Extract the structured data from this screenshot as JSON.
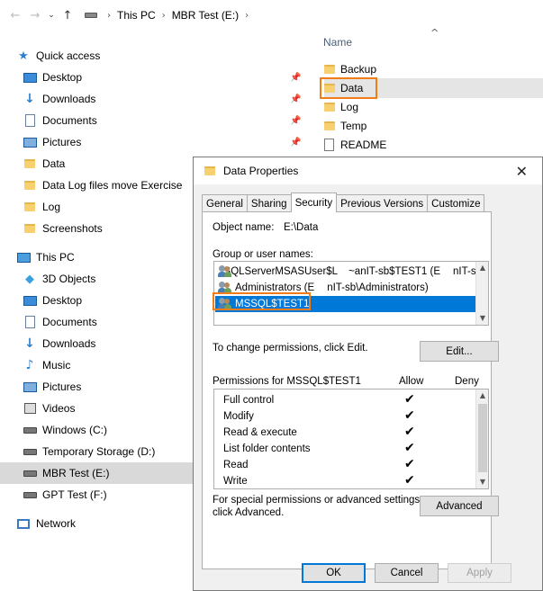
{
  "addressbar": {
    "back_icon": "arrow-left-icon",
    "forward_icon": "arrow-right-icon",
    "recent_icon": "chevron-down-icon",
    "up_icon": "arrow-up-icon",
    "breadcrumbs": [
      "This PC",
      "MBR Test (E:)"
    ]
  },
  "sidebar": {
    "quick_access_label": "Quick access",
    "quick_access": [
      {
        "label": "Desktop",
        "icon": "desktop-icon",
        "pinned": true
      },
      {
        "label": "Downloads",
        "icon": "downloads-icon",
        "pinned": true
      },
      {
        "label": "Documents",
        "icon": "documents-icon",
        "pinned": true
      },
      {
        "label": "Pictures",
        "icon": "pictures-icon",
        "pinned": true
      },
      {
        "label": "Data",
        "icon": "folder-icon",
        "pinned": false
      },
      {
        "label": "Data Log files move Exercise",
        "icon": "folder-icon",
        "pinned": false
      },
      {
        "label": "Log",
        "icon": "folder-icon",
        "pinned": false
      },
      {
        "label": "Screenshots",
        "icon": "folder-icon",
        "pinned": false
      }
    ],
    "this_pc_label": "This PC",
    "this_pc": [
      {
        "label": "3D Objects",
        "icon": "3d-objects-icon"
      },
      {
        "label": "Desktop",
        "icon": "desktop-icon"
      },
      {
        "label": "Documents",
        "icon": "documents-icon"
      },
      {
        "label": "Downloads",
        "icon": "downloads-icon"
      },
      {
        "label": "Music",
        "icon": "music-icon"
      },
      {
        "label": "Pictures",
        "icon": "pictures-icon"
      },
      {
        "label": "Videos",
        "icon": "videos-icon"
      },
      {
        "label": "Windows (C:)",
        "icon": "drive-icon"
      },
      {
        "label": "Temporary Storage (D:)",
        "icon": "drive-icon"
      },
      {
        "label": "MBR Test (E:)",
        "icon": "drive-icon",
        "selected": true
      },
      {
        "label": "GPT Test (F:)",
        "icon": "drive-icon"
      }
    ],
    "network_label": "Network"
  },
  "filepane": {
    "column_name": "Name",
    "files": [
      {
        "name": "Backup",
        "type": "folder"
      },
      {
        "name": "Data",
        "type": "folder",
        "highlighted": true
      },
      {
        "name": "Log",
        "type": "folder"
      },
      {
        "name": "Temp",
        "type": "folder"
      },
      {
        "name": "README",
        "type": "file"
      }
    ]
  },
  "dialog": {
    "title": "Data Properties",
    "tabs": [
      "General",
      "Sharing",
      "Security",
      "Previous Versions",
      "Customize"
    ],
    "active_tab": "Security",
    "object_name_label": "Object name:",
    "object_name_value": "E:\\Data",
    "group_label": "Group or user names:",
    "users": [
      {
        "name": "SQLServerMSASUser$L",
        "name_tail": "~anIT-sb$TEST1 (E",
        "name_tail2": "nIT-sb"
      },
      {
        "name": "Administrators (E",
        "name_tail": "nIT-sb\\Administrators)"
      },
      {
        "name": "MSSQL$TEST1",
        "selected": true
      }
    ],
    "change_perm_text": "To change permissions, click Edit.",
    "edit_button": "Edit...",
    "permissions_for": "Permissions for MSSQL$TEST1",
    "allow_header": "Allow",
    "deny_header": "Deny",
    "permissions": [
      {
        "name": "Full control",
        "allow": true,
        "deny": false
      },
      {
        "name": "Modify",
        "allow": true,
        "deny": false
      },
      {
        "name": "Read & execute",
        "allow": true,
        "deny": false
      },
      {
        "name": "List folder contents",
        "allow": true,
        "deny": false
      },
      {
        "name": "Read",
        "allow": true,
        "deny": false
      },
      {
        "name": "Write",
        "allow": true,
        "deny": false
      }
    ],
    "special_text_1": "For special permissions or advanced settings,",
    "special_text_2": "click Advanced.",
    "advanced_button": "Advanced",
    "ok_button": "OK",
    "cancel_button": "Cancel",
    "apply_button": "Apply",
    "close_glyph": "✕",
    "check_glyph": "✔"
  },
  "colors": {
    "selection": "#0078d7",
    "highlight_box": "#f07d1a",
    "folder": "#f7d070"
  }
}
